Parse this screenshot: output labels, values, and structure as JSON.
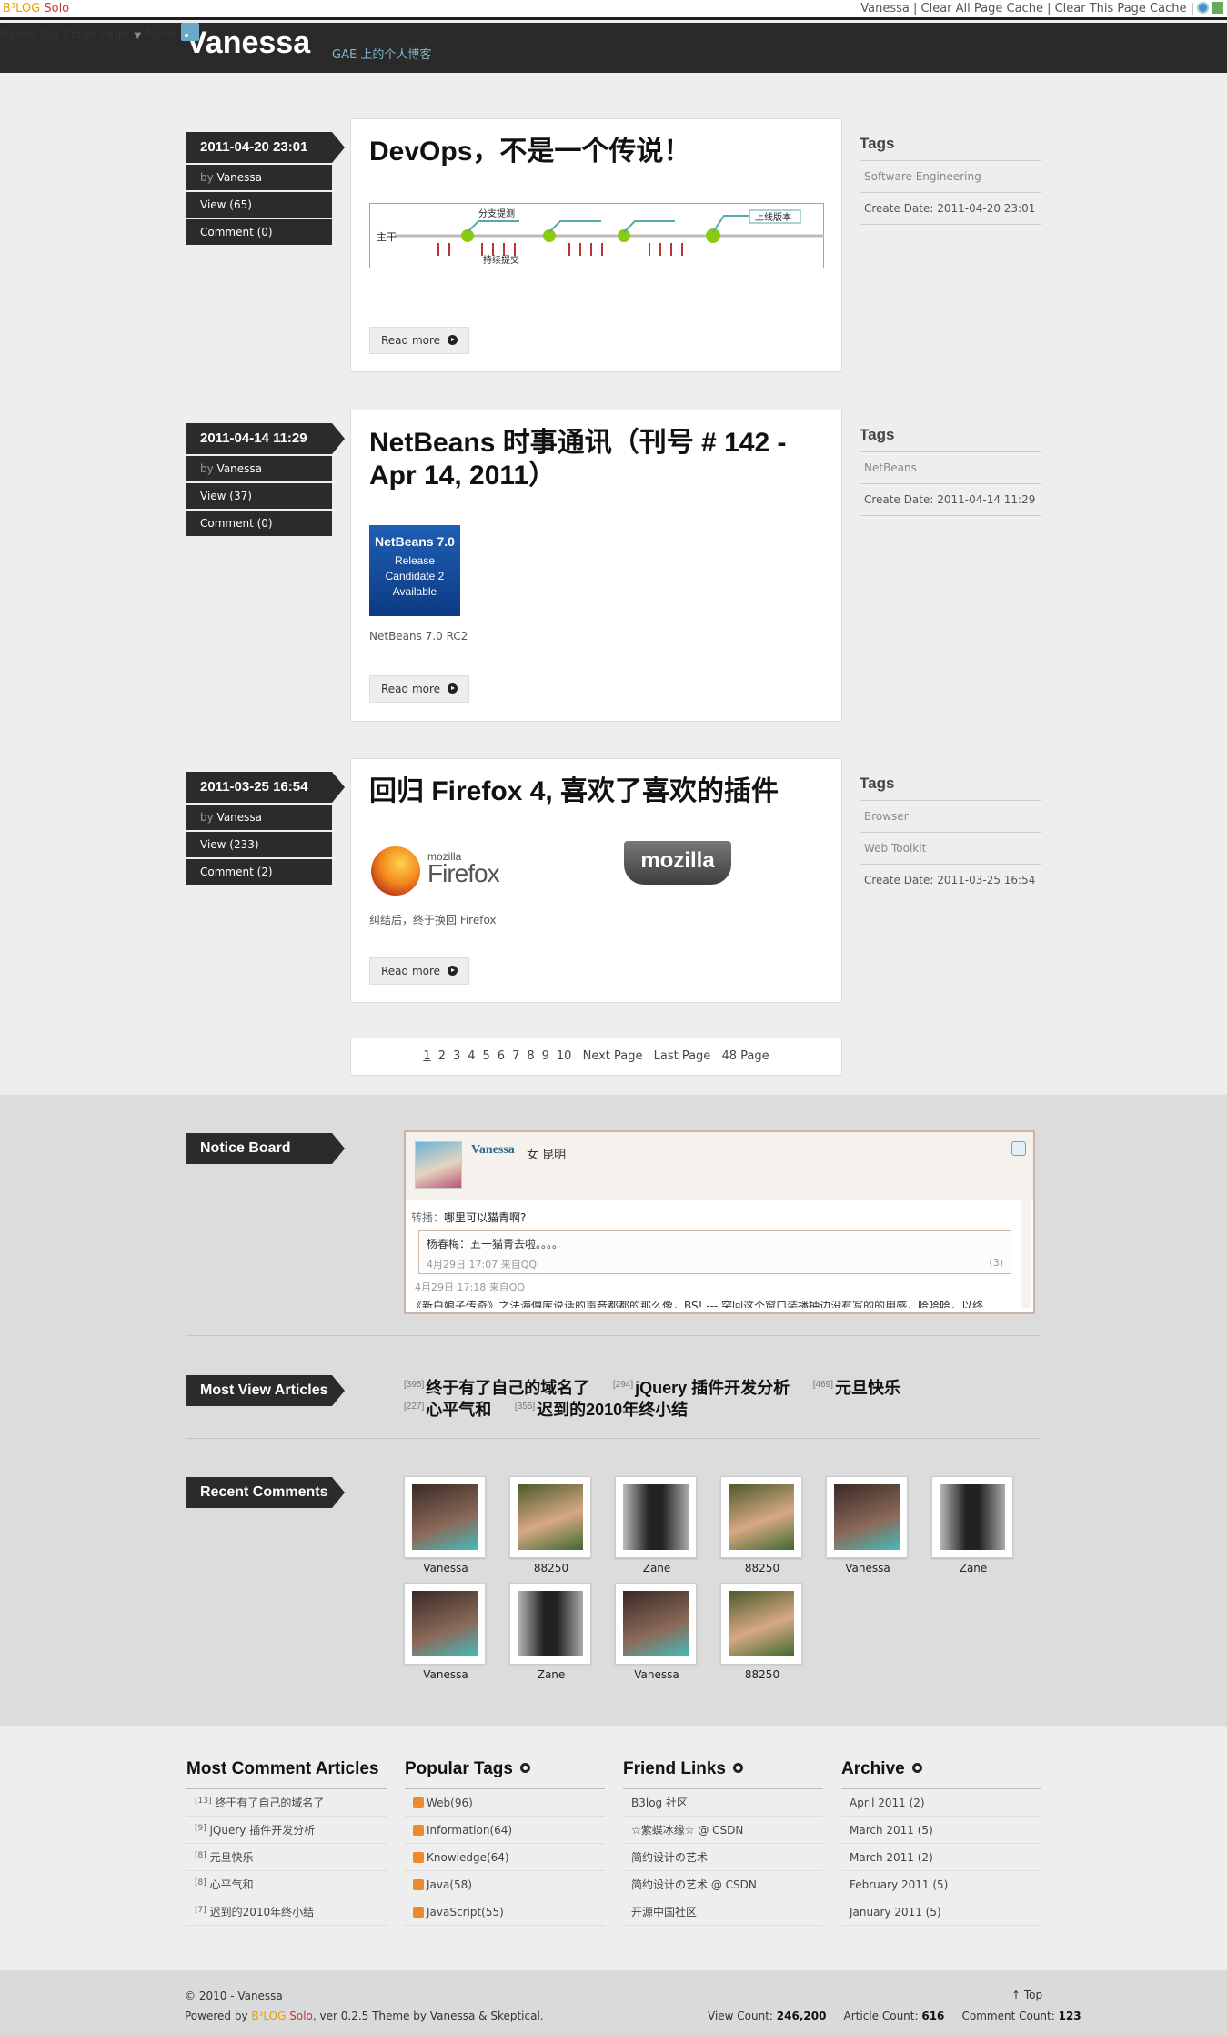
{
  "topbar": {
    "brand_b": "B³LOG",
    "brand_s": "Solo",
    "user": "Vanessa",
    "clear_all": "Clear All Page Cache",
    "clear_this": "Clear This Page Cache"
  },
  "header": {
    "logo": "Vanessa",
    "tagline": "GAE 上的个人博客",
    "nav": [
      "Home",
      "Tag Cloud",
      "Page",
      "Atom"
    ]
  },
  "posts": [
    {
      "date": "2011-04-20 23:01",
      "by": "by",
      "author": "Vanessa",
      "views": "View (65)",
      "comments": "Comment (0)",
      "title": "DevOps，不是一个传说！",
      "read_more": "Read more",
      "tags_title": "Tags",
      "tags": [
        "Software Engineering"
      ],
      "create_date": "Create Date: 2011-04-20 23:01",
      "diagram": {
        "trunk": "主干",
        "branch": "分支提测",
        "continuous": "持续提交",
        "release": "上线版本"
      }
    },
    {
      "date": "2011-04-14 11:29",
      "by": "by",
      "author": "Vanessa",
      "views": "View (37)",
      "comments": "Comment (0)",
      "title": "NetBeans 时事通讯（刊号 # 142 - Apr 14, 2011）",
      "image_text": [
        "NetBeans 7.0",
        "Release",
        "Candidate 2",
        "Available"
      ],
      "excerpt": "NetBeans 7.0 RC2",
      "read_more": "Read more",
      "tags_title": "Tags",
      "tags": [
        "NetBeans"
      ],
      "create_date": "Create Date: 2011-04-14 11:29"
    },
    {
      "date": "2011-03-25 16:54",
      "by": "by",
      "author": "Vanessa",
      "views": "View (233)",
      "comments": "Comment (2)",
      "title": "回归 Firefox 4, 喜欢了喜欢的插件",
      "firefox_small": "mozilla",
      "firefox_big": "Firefox",
      "mozilla": "mozilla",
      "excerpt": "纠结后，终于换回 Firefox",
      "read_more": "Read more",
      "tags_title": "Tags",
      "tags": [
        "Browser",
        "Web Toolkit"
      ],
      "create_date": "Create Date: 2011-03-25 16:54"
    }
  ],
  "pagination": {
    "pages": [
      "1",
      "2",
      "3",
      "4",
      "5",
      "6",
      "7",
      "8",
      "9",
      "10"
    ],
    "next": "Next Page",
    "last": "Last Page",
    "total": "48 Page"
  },
  "notice": {
    "label": "Notice Board",
    "name": "Vanessa",
    "info": "女  昆明",
    "q_prefix": "转播：",
    "q": "哪里可以猫青啊?",
    "reply": "杨春梅：五一猫青去啦。。。。",
    "reply_meta": "4月29日 17:07 来自QQ",
    "reply_count": "(3)",
    "meta": "4月29日 17:18 来自QQ",
    "cut": "《新白娘子传奇》之法海傳库说话的声音都都的那么像，BS! --- 突回这个窗口装播抽边没有写的的用感，哈哈哈，以终"
  },
  "most_view": {
    "label": "Most View Articles",
    "items": [
      {
        "count": "[395]",
        "title": "终于有了自己的域名了"
      },
      {
        "count": "[294]",
        "title": "jQuery 插件开发分析"
      },
      {
        "count": "[469]",
        "title": "元旦快乐"
      },
      {
        "count": "[227]",
        "title": "心平气和"
      },
      {
        "count": "[355]",
        "title": "迟到的2010年终小结"
      }
    ]
  },
  "recent_comments": {
    "label": "Recent Comments",
    "items": [
      "Vanessa",
      "88250",
      "Zane",
      "88250",
      "Vanessa",
      "Zane",
      "Vanessa",
      "Zane",
      "Vanessa",
      "88250"
    ]
  },
  "footer_cols": {
    "most_comment": {
      "title": "Most Comment Articles",
      "items": [
        {
          "n": "[13]",
          "t": "终于有了自己的域名了"
        },
        {
          "n": "[9]",
          "t": "jQuery 插件开发分析"
        },
        {
          "n": "[8]",
          "t": "元旦快乐"
        },
        {
          "n": "[8]",
          "t": "心平气和"
        },
        {
          "n": "[7]",
          "t": "迟到的2010年终小结"
        }
      ]
    },
    "popular_tags": {
      "title": "Popular Tags",
      "items": [
        "Web(96)",
        "Information(64)",
        "Knowledge(64)",
        "Java(58)",
        "JavaScript(55)"
      ]
    },
    "friend_links": {
      "title": "Friend Links",
      "items": [
        "B3log 社区",
        "☆紫蝶冰缘☆ @ CSDN",
        "简约设计の艺术",
        "简约设计の艺术 @ CSDN",
        "开源中国社区"
      ]
    },
    "archive": {
      "title": "Archive",
      "items": [
        "April 2011 (2)",
        "March 2011 (5)",
        "March 2011 (2)",
        "February 2011 (5)",
        "January 2011 (5)"
      ]
    }
  },
  "footer": {
    "copy": "© 2010 - ",
    "owner": "Vanessa",
    "powered": "Powered by ",
    "b3": "B³LOG",
    "solo": "Solo",
    "ver": ", ver 0.2.5   Theme by ",
    "theme1": "Vanessa",
    "amp": " & ",
    "theme2": "Skeptical",
    "dot": ".",
    "top": "Top",
    "view_label": "View Count: ",
    "view": "246,200",
    "article_label": "Article Count: ",
    "article": "616",
    "comment_label": "Comment Count: ",
    "comment": "123"
  }
}
